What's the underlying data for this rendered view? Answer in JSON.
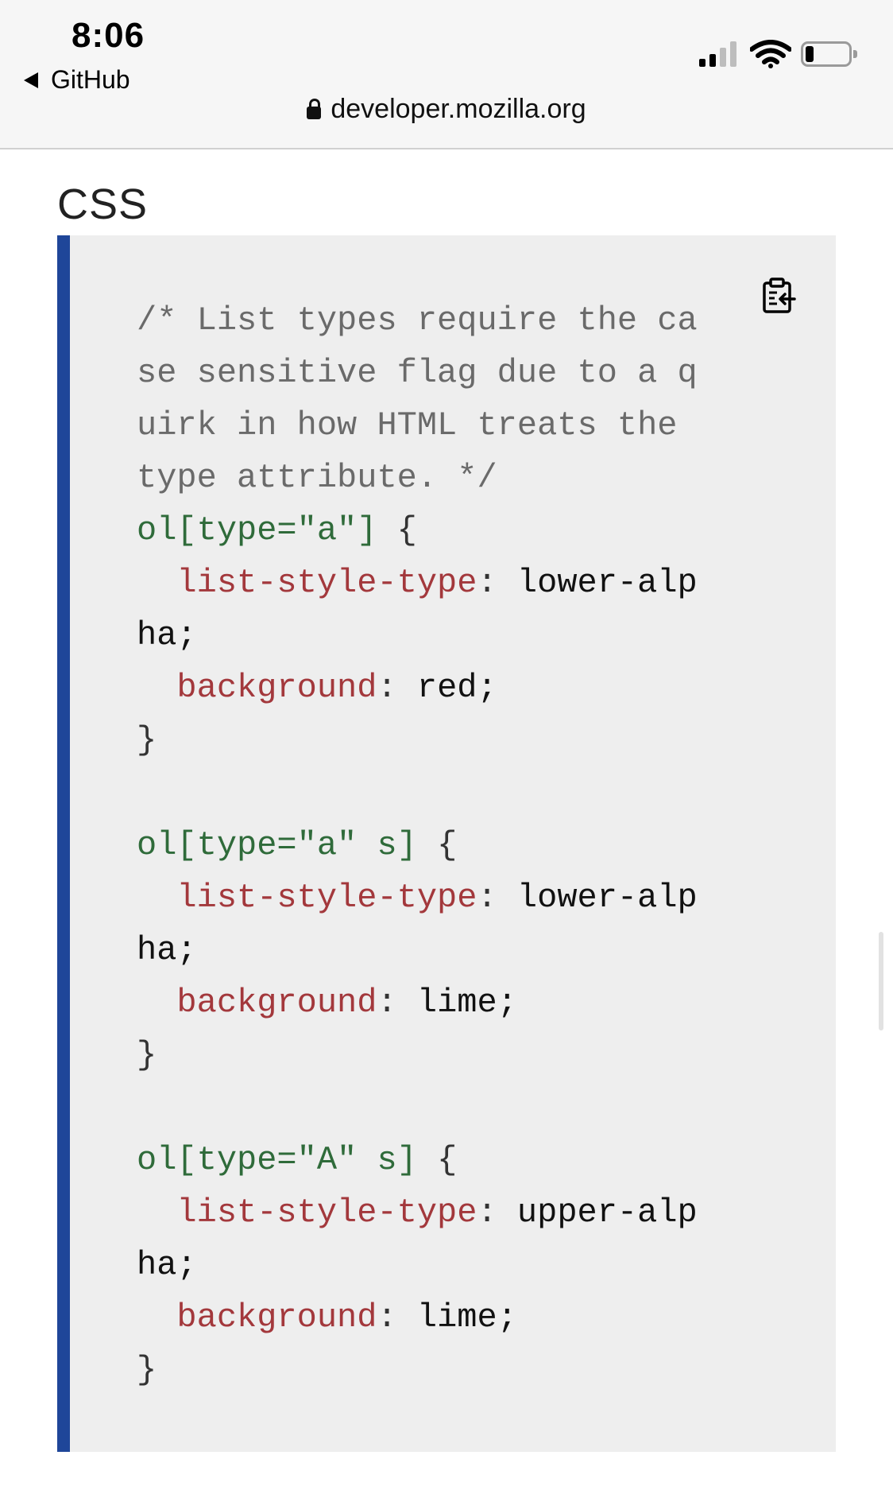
{
  "status_bar": {
    "time": "8:06",
    "back_app": "GitHub",
    "signal_bars_filled": 2,
    "signal_bars_total": 4,
    "battery_level_fraction": 0.2
  },
  "browser": {
    "domain": "developer.mozilla.org"
  },
  "section": {
    "heading": "CSS"
  },
  "code": {
    "accent_color": "#1f4699",
    "lines": [
      [
        {
          "t": "/* List types require the ca",
          "k": "comment"
        }
      ],
      [
        {
          "t": "se sensitive flag due to a q",
          "k": "comment"
        }
      ],
      [
        {
          "t": "uirk in how HTML treats the ",
          "k": "comment"
        }
      ],
      [
        {
          "t": "type attribute. */",
          "k": "comment"
        }
      ],
      [
        {
          "t": "ol[type=\"a\"]",
          "k": "sel"
        },
        {
          "t": " {",
          "k": "punct"
        }
      ],
      [
        {
          "t": "  list-style-type",
          "k": "prop"
        },
        {
          "t": ": ",
          "k": "punct"
        },
        {
          "t": "lower-alp",
          "k": "val"
        }
      ],
      [
        {
          "t": "ha;",
          "k": "val"
        }
      ],
      [
        {
          "t": "  background",
          "k": "prop"
        },
        {
          "t": ": ",
          "k": "punct"
        },
        {
          "t": "red;",
          "k": "val"
        }
      ],
      [
        {
          "t": "}",
          "k": "punct"
        }
      ],
      [
        {
          "t": "",
          "k": "val"
        }
      ],
      [
        {
          "t": "ol[type=\"a\" s]",
          "k": "sel"
        },
        {
          "t": " {",
          "k": "punct"
        }
      ],
      [
        {
          "t": "  list-style-type",
          "k": "prop"
        },
        {
          "t": ": ",
          "k": "punct"
        },
        {
          "t": "lower-alp",
          "k": "val"
        }
      ],
      [
        {
          "t": "ha;",
          "k": "val"
        }
      ],
      [
        {
          "t": "  background",
          "k": "prop"
        },
        {
          "t": ": ",
          "k": "punct"
        },
        {
          "t": "lime;",
          "k": "val"
        }
      ],
      [
        {
          "t": "}",
          "k": "punct"
        }
      ],
      [
        {
          "t": "",
          "k": "val"
        }
      ],
      [
        {
          "t": "ol[type=\"A\" s]",
          "k": "sel"
        },
        {
          "t": " {",
          "k": "punct"
        }
      ],
      [
        {
          "t": "  list-style-type",
          "k": "prop"
        },
        {
          "t": ": ",
          "k": "punct"
        },
        {
          "t": "upper-alp",
          "k": "val"
        }
      ],
      [
        {
          "t": "ha;",
          "k": "val"
        }
      ],
      [
        {
          "t": "  background",
          "k": "prop"
        },
        {
          "t": ": ",
          "k": "punct"
        },
        {
          "t": "lime;",
          "k": "val"
        }
      ],
      [
        {
          "t": "}",
          "k": "punct"
        }
      ]
    ]
  },
  "icons": {
    "back": "back-triangle-icon",
    "lock": "lock-icon",
    "copy": "clipboard-copy-icon",
    "wifi": "wifi-icon",
    "battery": "battery-icon",
    "signal": "signal-icon"
  }
}
